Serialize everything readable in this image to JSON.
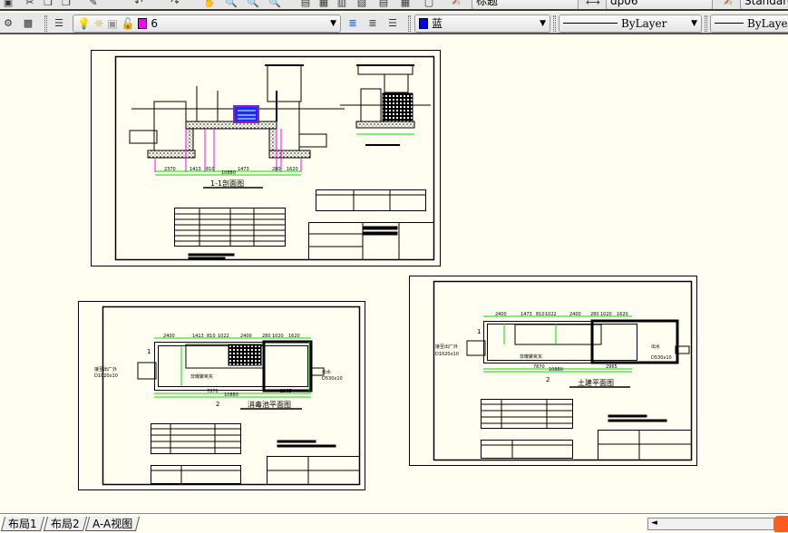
{
  "toolbar_top": {
    "text_style": "标题",
    "dim_style": "dp06",
    "table_style": "Standard"
  },
  "layers_toolbar": {
    "current_layer": "6",
    "layer_color": "#ff00ff"
  },
  "properties_toolbar": {
    "color_label": "蓝",
    "color": "#0000ff",
    "linetype": "ByLayer",
    "lineweight": "ByLayer"
  },
  "drawings": {
    "section": {
      "title": "1-1剖面图",
      "dims": [
        "2370",
        "1413",
        "810",
        "1473",
        "280",
        "1620"
      ],
      "total": "10880"
    },
    "disinfect_plan": {
      "title": "消毒池平面图",
      "inlet_label": "接至出厂外",
      "inlet_size": "D1020x10",
      "outlet_label": "出水",
      "outlet_size": "D530x10",
      "center_label": "非曝聚氧实",
      "dims": [
        "2400",
        "1413",
        "810",
        "1022",
        "2400",
        "280",
        "1020",
        "1620"
      ],
      "dim_a": "7870",
      "dim_b": "2965",
      "total": "10880",
      "sec1": "1",
      "sec2": "2"
    },
    "civil_plan": {
      "title": "土建平面图",
      "inlet_label": "接至出厂外",
      "inlet_size": "D1020x10",
      "outlet_label": "出水",
      "outlet_size": "D530x10",
      "center_label": "非曝聚氧实",
      "dims": [
        "2400",
        "1473",
        "810",
        "1022",
        "2400",
        "280",
        "1020",
        "1620"
      ],
      "dim_a": "7870",
      "dim_b": "2965",
      "total": "10880",
      "sec1": "1",
      "sec2": "2"
    }
  },
  "layout_tabs": [
    "布局1",
    "布局2",
    "A-A视图"
  ]
}
